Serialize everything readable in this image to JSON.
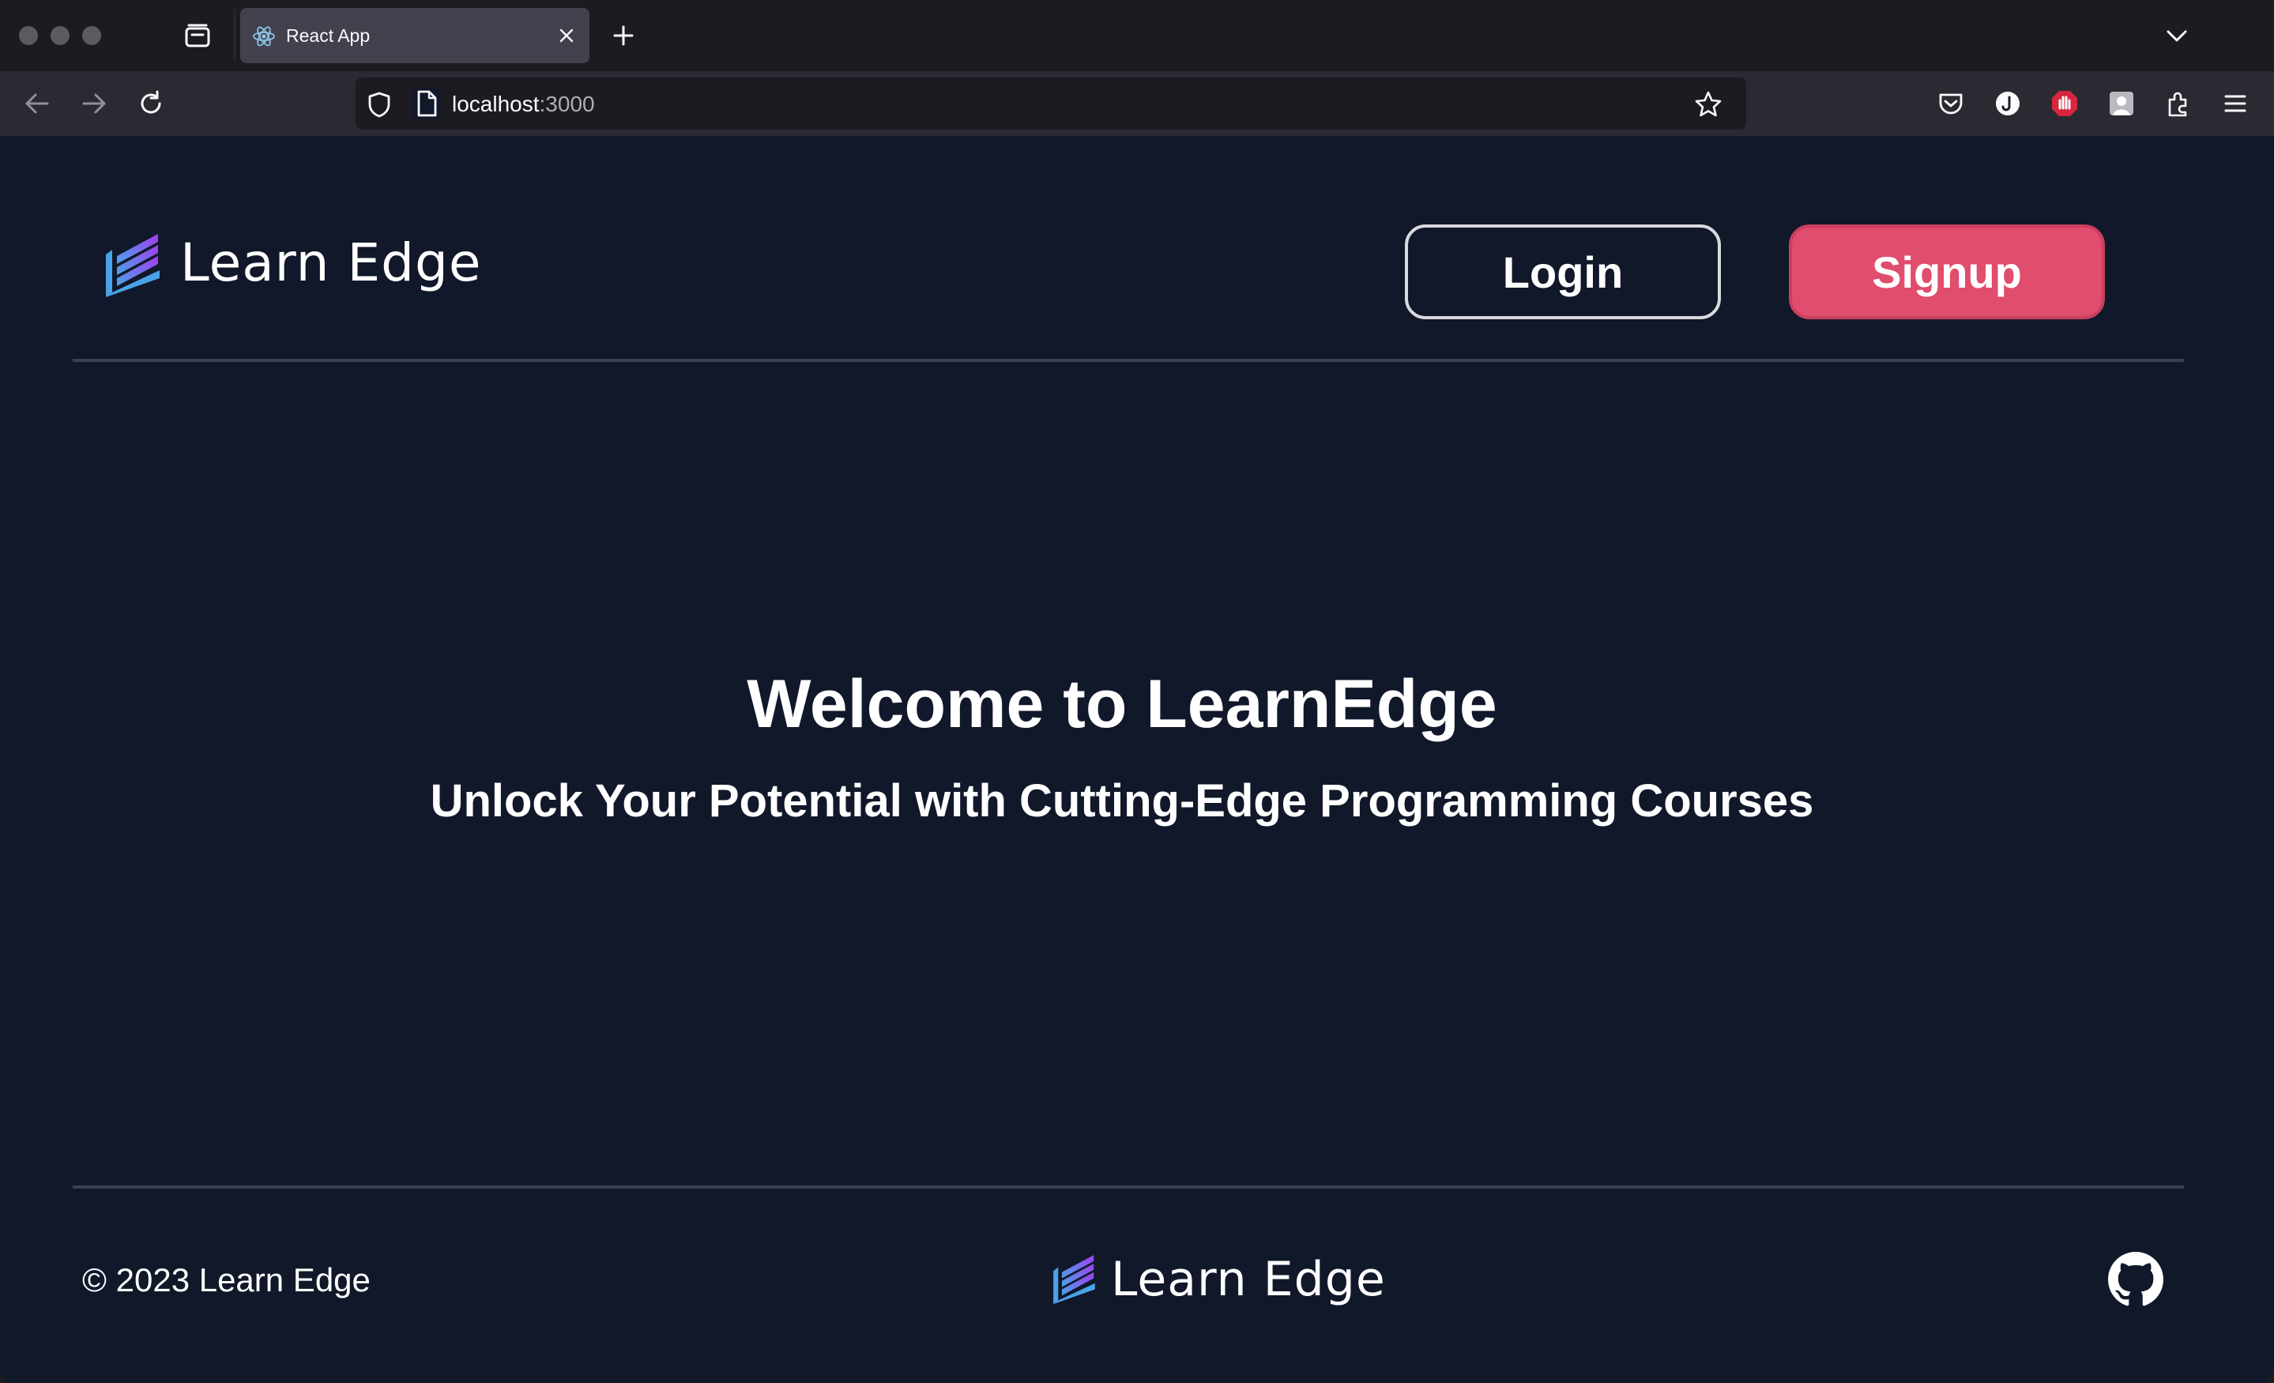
{
  "browser": {
    "tab": {
      "title": "React App",
      "favicon": "react-icon"
    },
    "url": {
      "host": "localhost",
      "port": ":3000"
    },
    "toolbar_icons": [
      "back-icon",
      "forward-icon",
      "reload-icon",
      "pocket-icon",
      "account-icon",
      "adblock-icon",
      "profile-icon",
      "extensions-icon",
      "menu-icon"
    ]
  },
  "header": {
    "brand": "Learn Edge",
    "login_label": "Login",
    "signup_label": "Signup"
  },
  "hero": {
    "title": "Welcome to LearnEdge",
    "subtitle": "Unlock Your Potential with Cutting-Edge Programming Courses"
  },
  "footer": {
    "copyright": "© 2023 Learn Edge",
    "brand": "Learn Edge",
    "github_icon": "github-icon"
  },
  "colors": {
    "page_bg": "#11182a",
    "signup_bg": "#e04d6d",
    "logo_gradient": [
      "#4aa3e8",
      "#a23cf0"
    ]
  }
}
